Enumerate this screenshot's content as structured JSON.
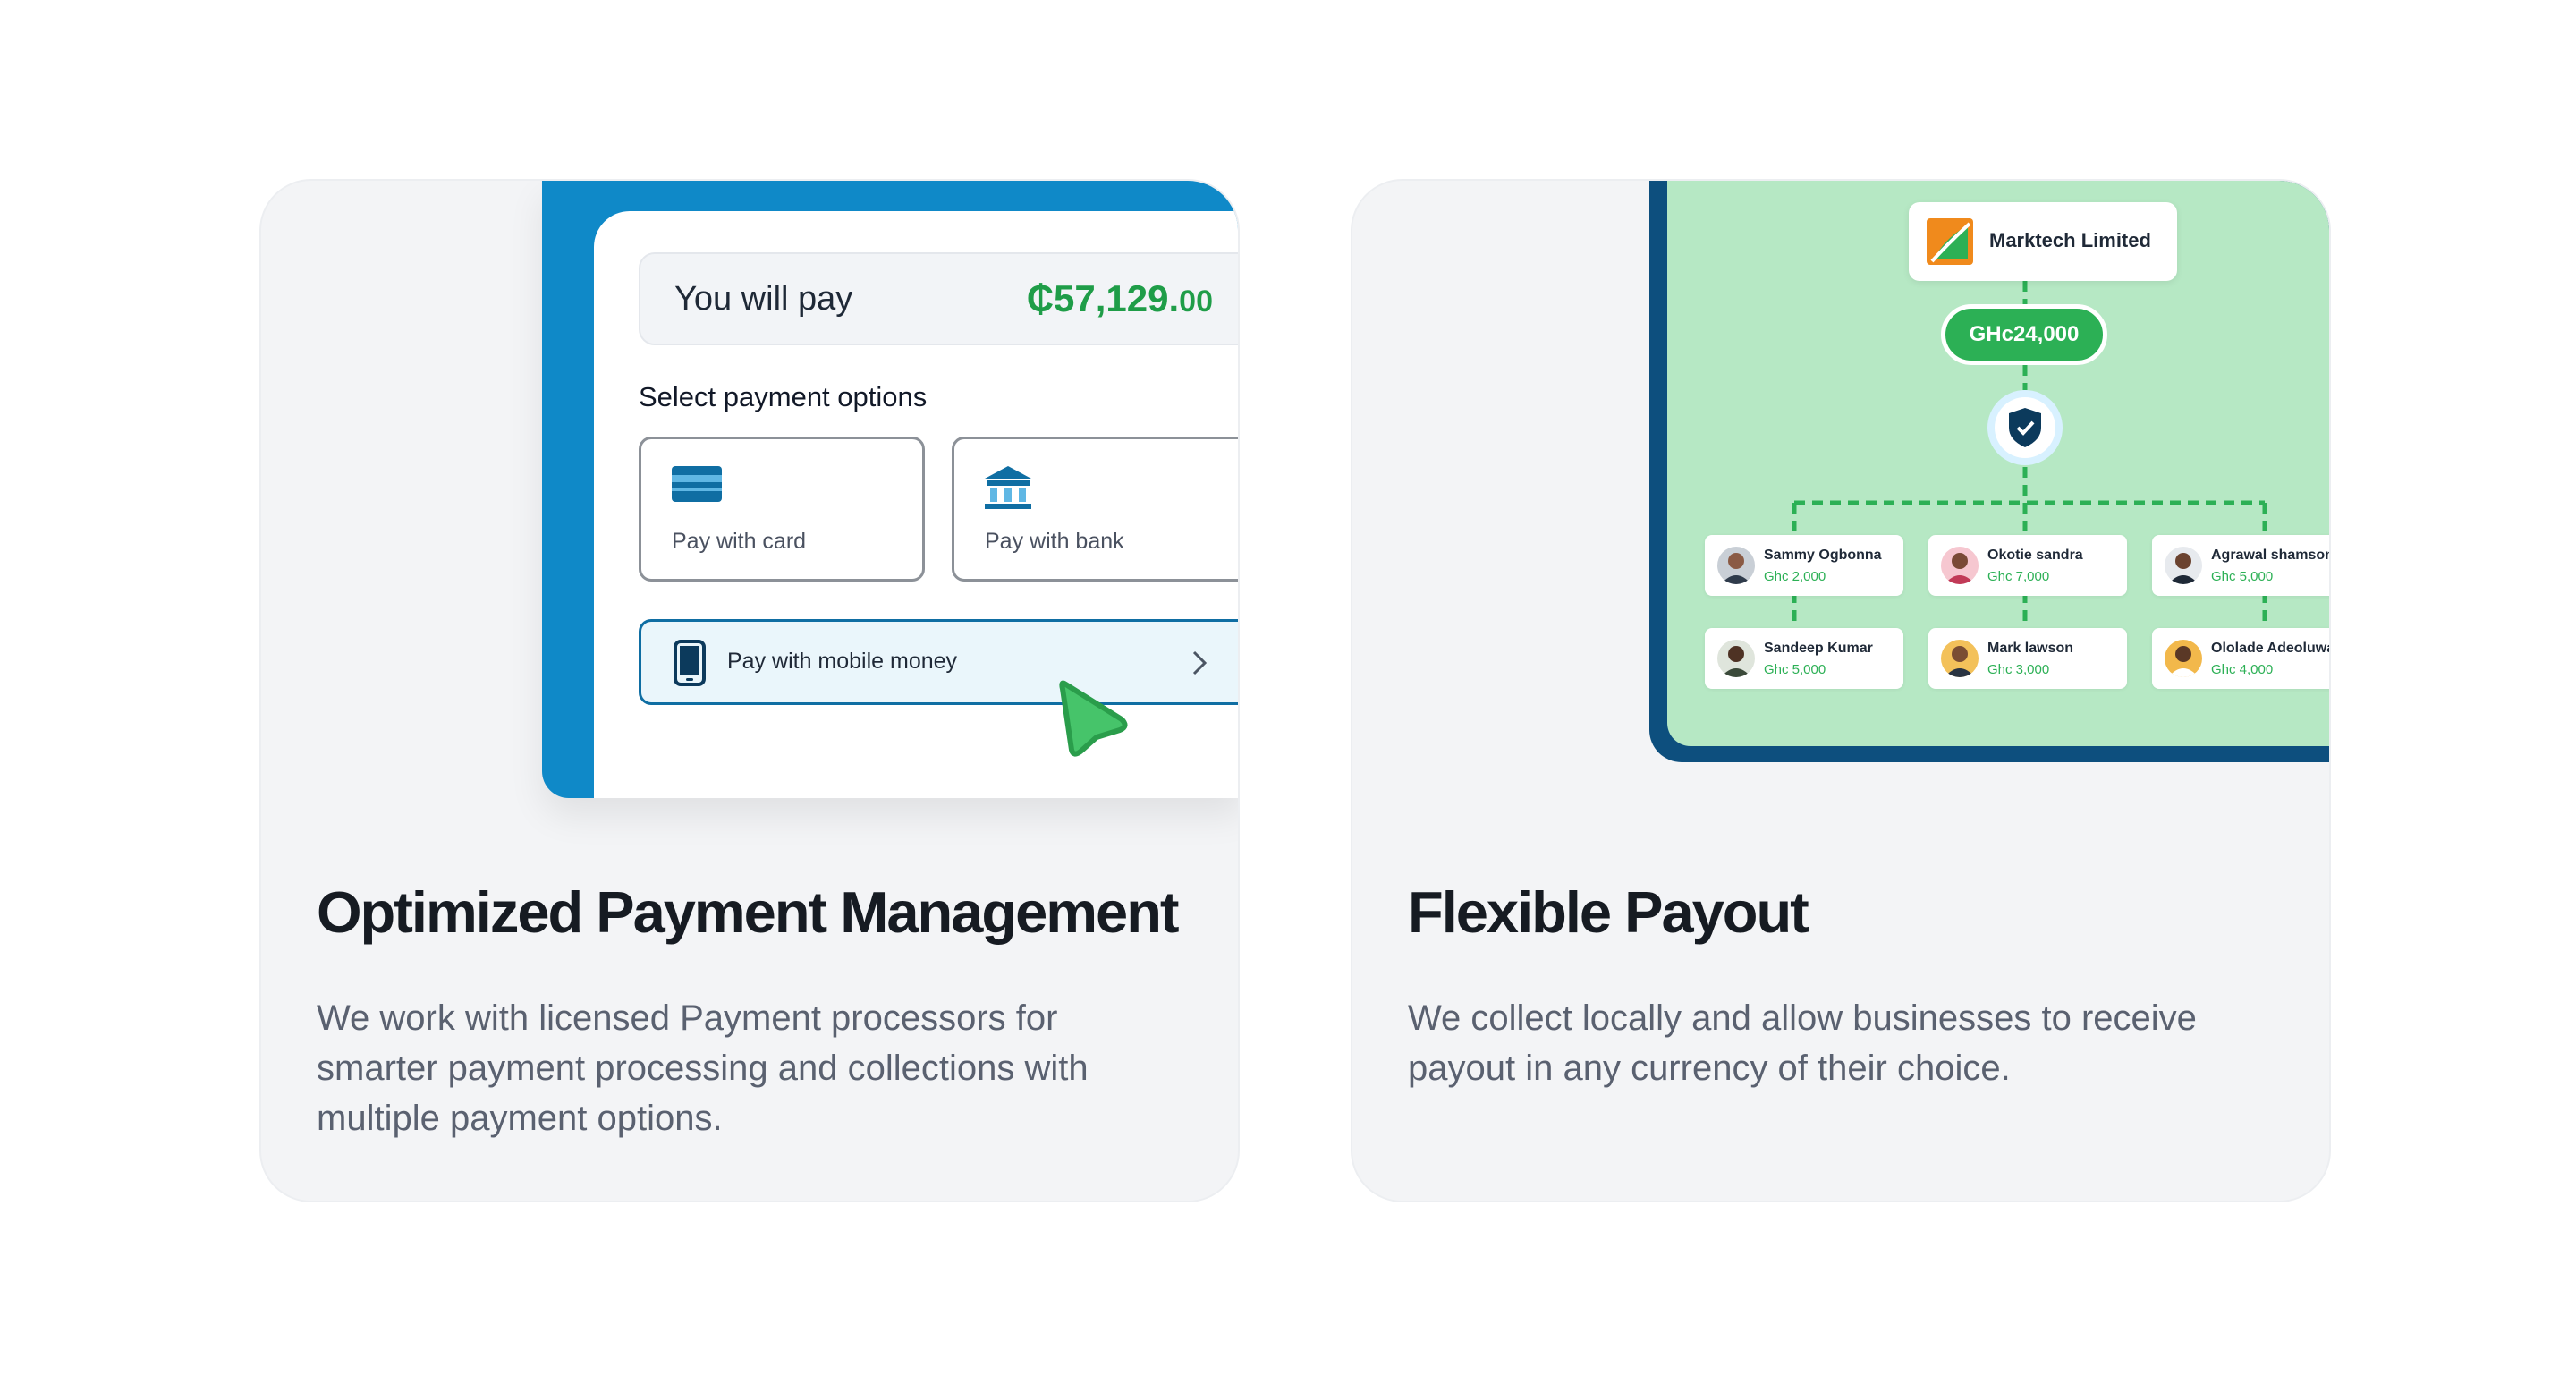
{
  "cards": [
    {
      "title": "Optimized Payment Management",
      "description": "We work with licensed Payment processors for smarter payment processing and collections with multiple payment options.",
      "illustration": {
        "amount_label": "You will pay",
        "amount_main": "₵57,129.",
        "amount_decimal": "00",
        "select_label": "Select payment options",
        "options": [
          {
            "label": "Pay with card",
            "icon": "credit-card-icon"
          },
          {
            "label": "Pay with bank",
            "icon": "bank-icon"
          }
        ],
        "mobile_money": {
          "label": "Pay with mobile money",
          "icon": "phone-icon"
        }
      }
    },
    {
      "title": "Flexible Payout",
      "description": "We collect locally and allow businesses to receive payout in any currency of their choice.",
      "illustration": {
        "company": "Marktech Limited",
        "total": "GHc24,000",
        "people": [
          {
            "name": "Sammy Ogbonna",
            "amount": "Ghc 2,000"
          },
          {
            "name": "Okotie sandra",
            "amount": "Ghc 7,000"
          },
          {
            "name": "Agrawal shamson",
            "amount": "Ghc 5,000"
          },
          {
            "name": "Sandeep Kumar",
            "amount": "Ghc 5,000"
          },
          {
            "name": "Mark lawson",
            "amount": "Ghc 3,000"
          },
          {
            "name": "Ololade Adeoluwa",
            "amount": "Ghc 4,000"
          }
        ]
      }
    }
  ],
  "colors": {
    "brand_blue": "#0f89c8",
    "dark_blue": "#0d4f7e",
    "green": "#2cb055",
    "mint": "#b6e8c4"
  }
}
